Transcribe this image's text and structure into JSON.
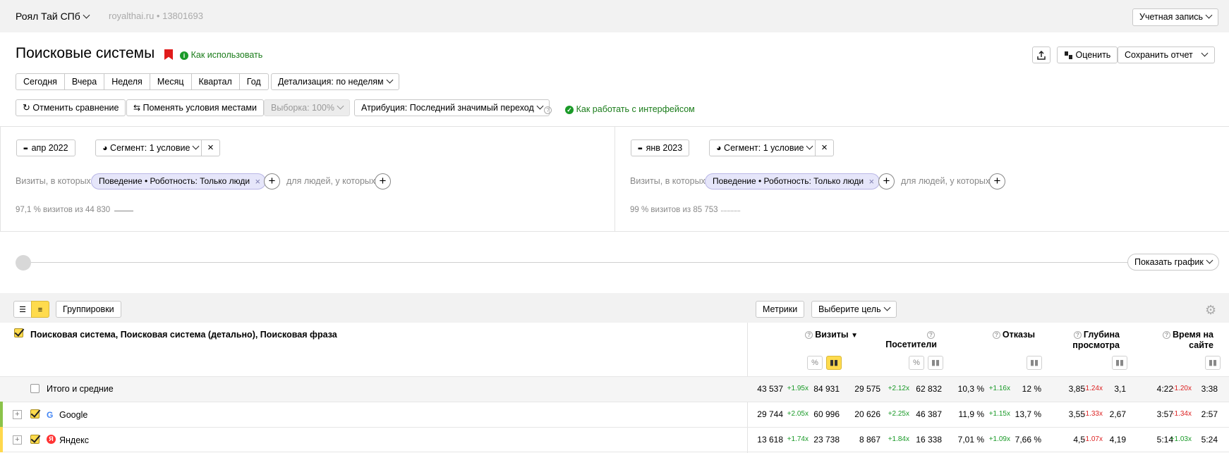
{
  "topbar": {
    "counter_name": "Роял Тай СПб",
    "site": "royalthai.ru",
    "counter_id": "13801693",
    "account_label": "Учетная запись"
  },
  "header": {
    "title": "Поисковые системы",
    "how_to_use": "Как использовать",
    "rate_label": "Оценить",
    "save_report": "Сохранить отчет"
  },
  "periods": [
    "Сегодня",
    "Вчера",
    "Неделя",
    "Месяц",
    "Квартал",
    "Год"
  ],
  "detail_label": "Детализация: по неделям",
  "controls": {
    "cancel_compare": "Отменить сравнение",
    "swap_conditions": "Поменять условия местами",
    "sample": "Выборка: 100%",
    "attribution": "Атрибуция: Последний значимый переход",
    "how_to_work": "Как работать с интерфейсом"
  },
  "segments": [
    {
      "period": "апр 2022",
      "segment": "Сегмент: 1 условие",
      "visits_label": "Визиты, в которых",
      "chip": "Поведение • Роботность: Только люди",
      "people_label": "для людей, у которых",
      "summary": "97,1 % визитов из 44 830"
    },
    {
      "period": "янв 2023",
      "segment": "Сегмент: 1 условие",
      "visits_label": "Визиты, в которых",
      "chip": "Поведение • Роботность: Только люди",
      "people_label": "для людей, у которых",
      "summary": "99 % визитов из 85 753"
    }
  ],
  "chart_toggle": "Показать график",
  "table_toolbar": {
    "groupings": "Группировки",
    "metrics": "Метрики",
    "goal": "Выберите цель"
  },
  "table": {
    "dimension_header": "Поисковая система, Поисковая система (детально), Поисковая фраза",
    "col_visits": "Визиты",
    "col_users": "Посетители",
    "col_bounce": "Отказы",
    "col_depth_1": "Глубина",
    "col_depth_2": "просмотра",
    "col_time_1": "Время на",
    "col_time_2": "сайте",
    "pct_label": "%",
    "rows": [
      {
        "label": "Итого и средние",
        "visits_a": "43 537",
        "visits_d": "+1.95x",
        "visits_b": "84 931",
        "users_a": "29 575",
        "users_d": "+2.12x",
        "users_b": "62 832",
        "bounce_a": "10,3 %",
        "bounce_d": "+1.16x",
        "bounce_b": "12 %",
        "depth_a": "3,85",
        "depth_d": "-1.24x",
        "depth_b": "3,1",
        "time_a": "4:22",
        "time_d": "-1.20x",
        "time_b": "3:38"
      },
      {
        "label": "Google",
        "visits_a": "29 744",
        "visits_d": "+2.05x",
        "visits_b": "60 996",
        "users_a": "20 626",
        "users_d": "+2.25x",
        "users_b": "46 387",
        "bounce_a": "11,9 %",
        "bounce_d": "+1.15x",
        "bounce_b": "13,7 %",
        "depth_a": "3,55",
        "depth_d": "-1.33x",
        "depth_b": "2,67",
        "time_a": "3:57",
        "time_d": "-1.34x",
        "time_b": "2:57"
      },
      {
        "label": "Яндекс",
        "visits_a": "13 618",
        "visits_d": "+1.74x",
        "visits_b": "23 738",
        "users_a": "8 867",
        "users_d": "+1.84x",
        "users_b": "16 338",
        "bounce_a": "7,01 %",
        "bounce_d": "+1.09x",
        "bounce_b": "7,66 %",
        "depth_a": "4,5",
        "depth_d": "-1.07x",
        "depth_b": "4,19",
        "time_a": "5:14",
        "time_d": "+1.03x",
        "time_b": "5:24"
      }
    ]
  },
  "colors": {
    "positive": "#1a9a28",
    "negative": "#dd2222",
    "accent_yellow": "#ffdb4d",
    "google_bar": "#8bc34a",
    "yandex_bar": "#ffd84d"
  }
}
